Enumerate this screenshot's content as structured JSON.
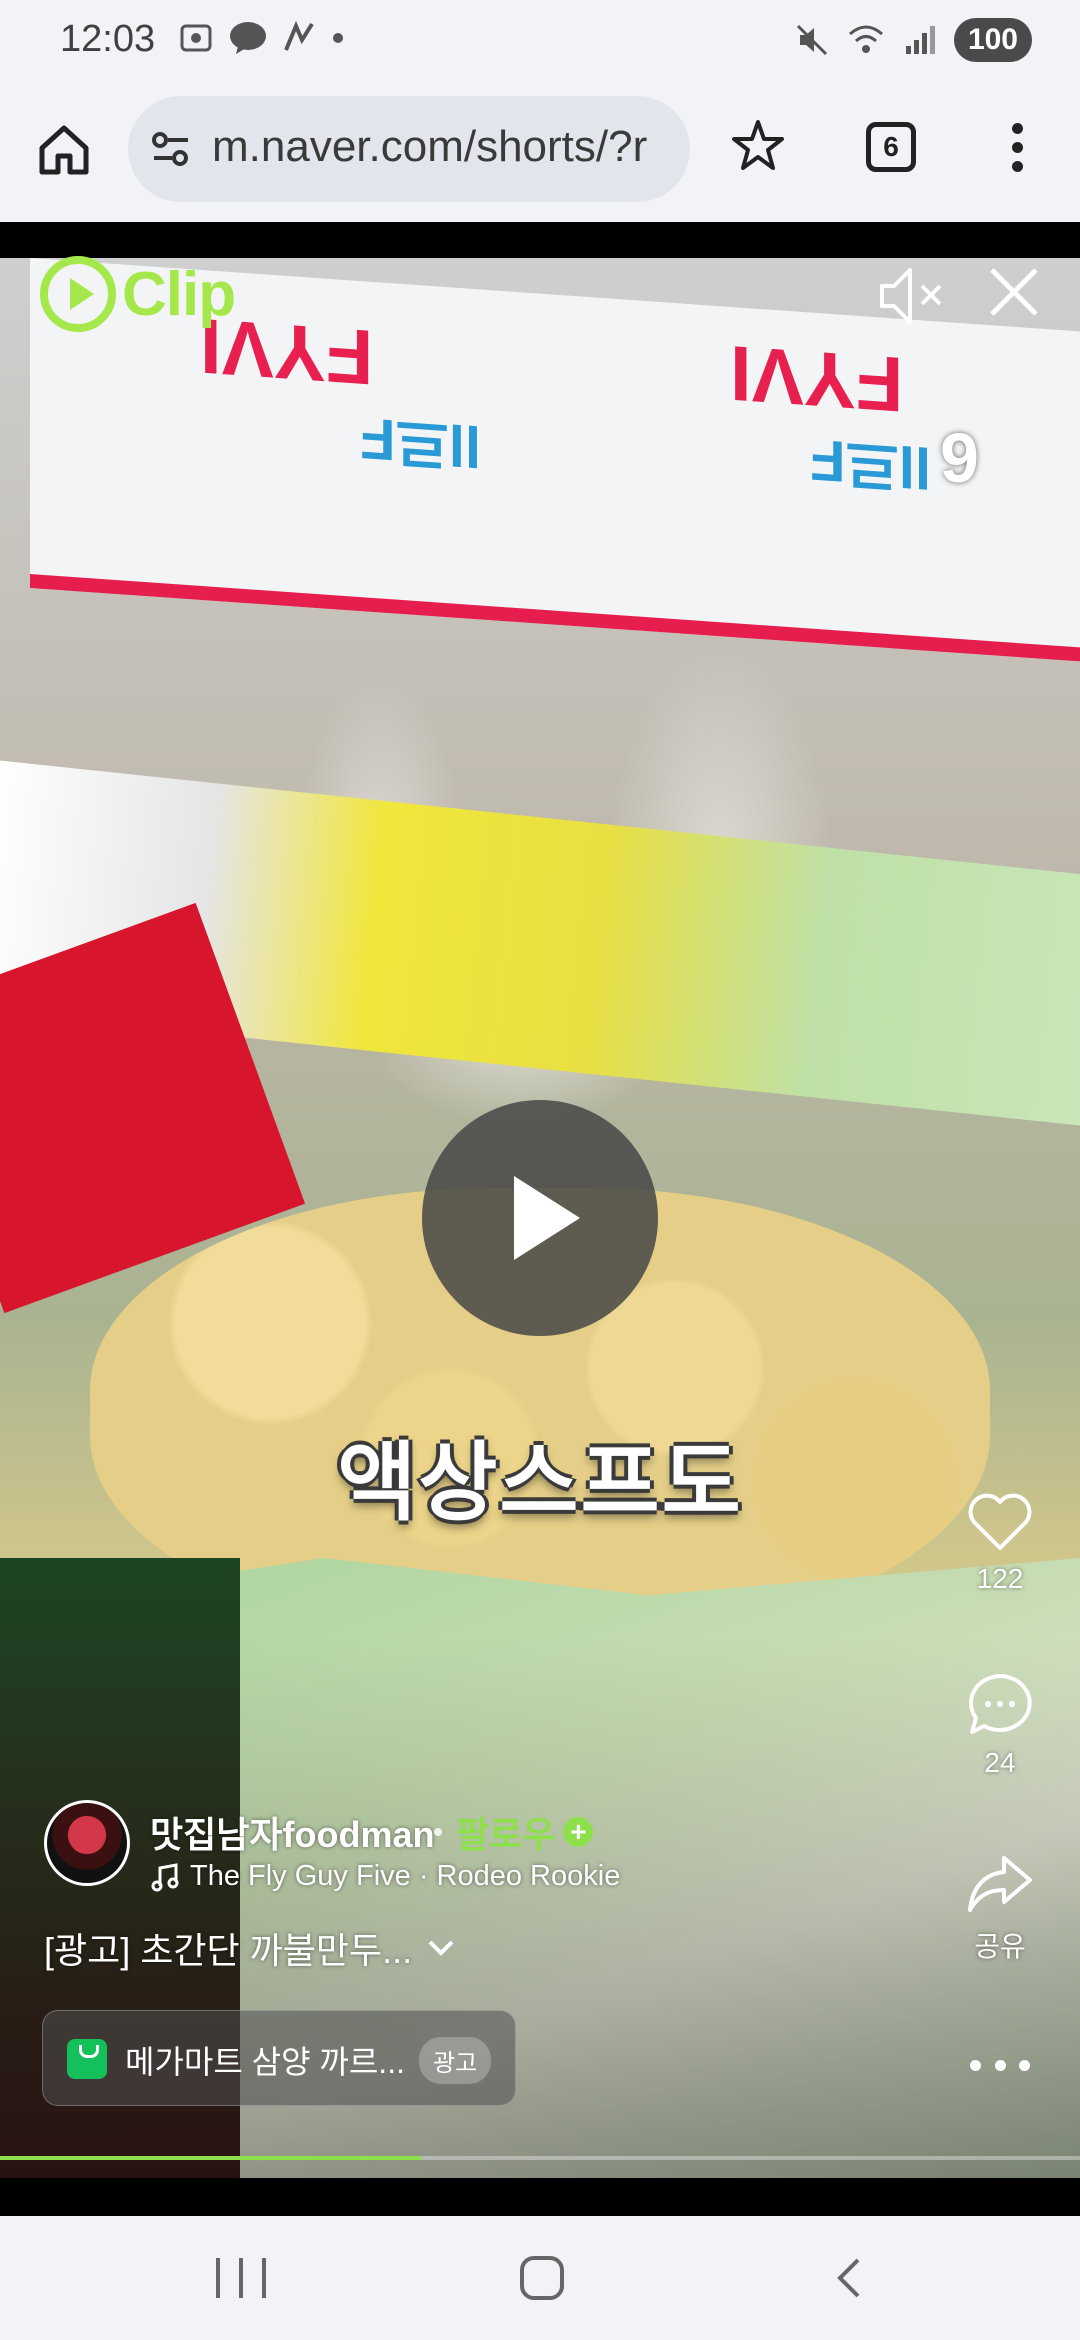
{
  "status_bar": {
    "time": "12:03",
    "battery": "100"
  },
  "browser": {
    "url": "m.naver.com/shorts/?r",
    "tab_count": "6"
  },
  "video": {
    "brand": "Clip",
    "overlay_number": "9",
    "subtitle": "액상스프도",
    "progress_fraction": 0.39
  },
  "actions": {
    "like_count": "122",
    "comment_count": "24",
    "share_label": "공유"
  },
  "author": {
    "name": "맛집남자foodman",
    "follow_label": "팔로우",
    "music": "The Fly Guy Five · Rodeo Rookie"
  },
  "caption": "[광고] 초간단 까불만두...",
  "ad": {
    "text": "메가마트 삼양 까르...",
    "badge": "광고"
  },
  "colors": {
    "accent_green": "#8ee04a",
    "clip_green": "#a4e84b"
  }
}
